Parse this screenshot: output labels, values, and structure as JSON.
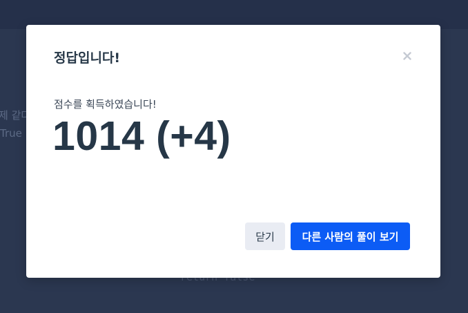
{
  "background": {
    "text_line_1": "제 같다",
    "text_line_2": "True",
    "code_line": "return false"
  },
  "modal": {
    "title": "정답입니다!",
    "close_icon": "close-icon",
    "score_label": "점수를 획득하였습니다!",
    "score_value": "1014 (+4)",
    "buttons": {
      "close_label": "닫기",
      "primary_label": "다른 사람의 풀이 보기"
    }
  },
  "colors": {
    "overlay": "#2b3750",
    "modal_bg": "#ffffff",
    "text_dark": "#263747",
    "primary": "#0c5cf5",
    "secondary_bg": "#e9ecf3"
  }
}
